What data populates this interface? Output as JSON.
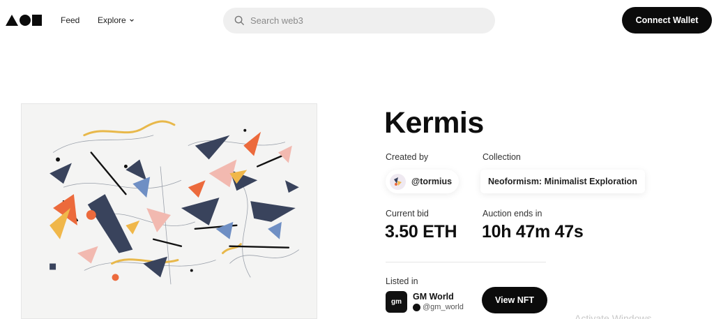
{
  "header": {
    "nav": {
      "feed": "Feed",
      "explore": "Explore"
    },
    "search": {
      "placeholder": "Search web3",
      "value": ""
    },
    "connect_wallet": "Connect Wallet"
  },
  "nft": {
    "title": "Kermis",
    "created_by_label": "Created by",
    "creator_handle": "@tormius",
    "collection_label": "Collection",
    "collection_name": "Neoformism: Minimalist Exploration",
    "current_bid_label": "Current bid",
    "current_bid": "3.50 ETH",
    "auction_label": "Auction ends in",
    "auction_remaining": "10h 47m 47s",
    "listed_in_label": "Listed in",
    "listed_in": {
      "logo_text": "gm",
      "name": "GM World",
      "handle": "@gm_world"
    },
    "view_button": "View NFT"
  },
  "watermark": "Activate Windows",
  "icons": {
    "logo": "triangle-circle-square-logo",
    "search": "search-icon",
    "explore_dropdown": "chevron-down-icon"
  },
  "colors": {
    "accent": "#0b0b0b",
    "search_bg": "#efefef",
    "artwork_bg": "#f4f4f3"
  }
}
